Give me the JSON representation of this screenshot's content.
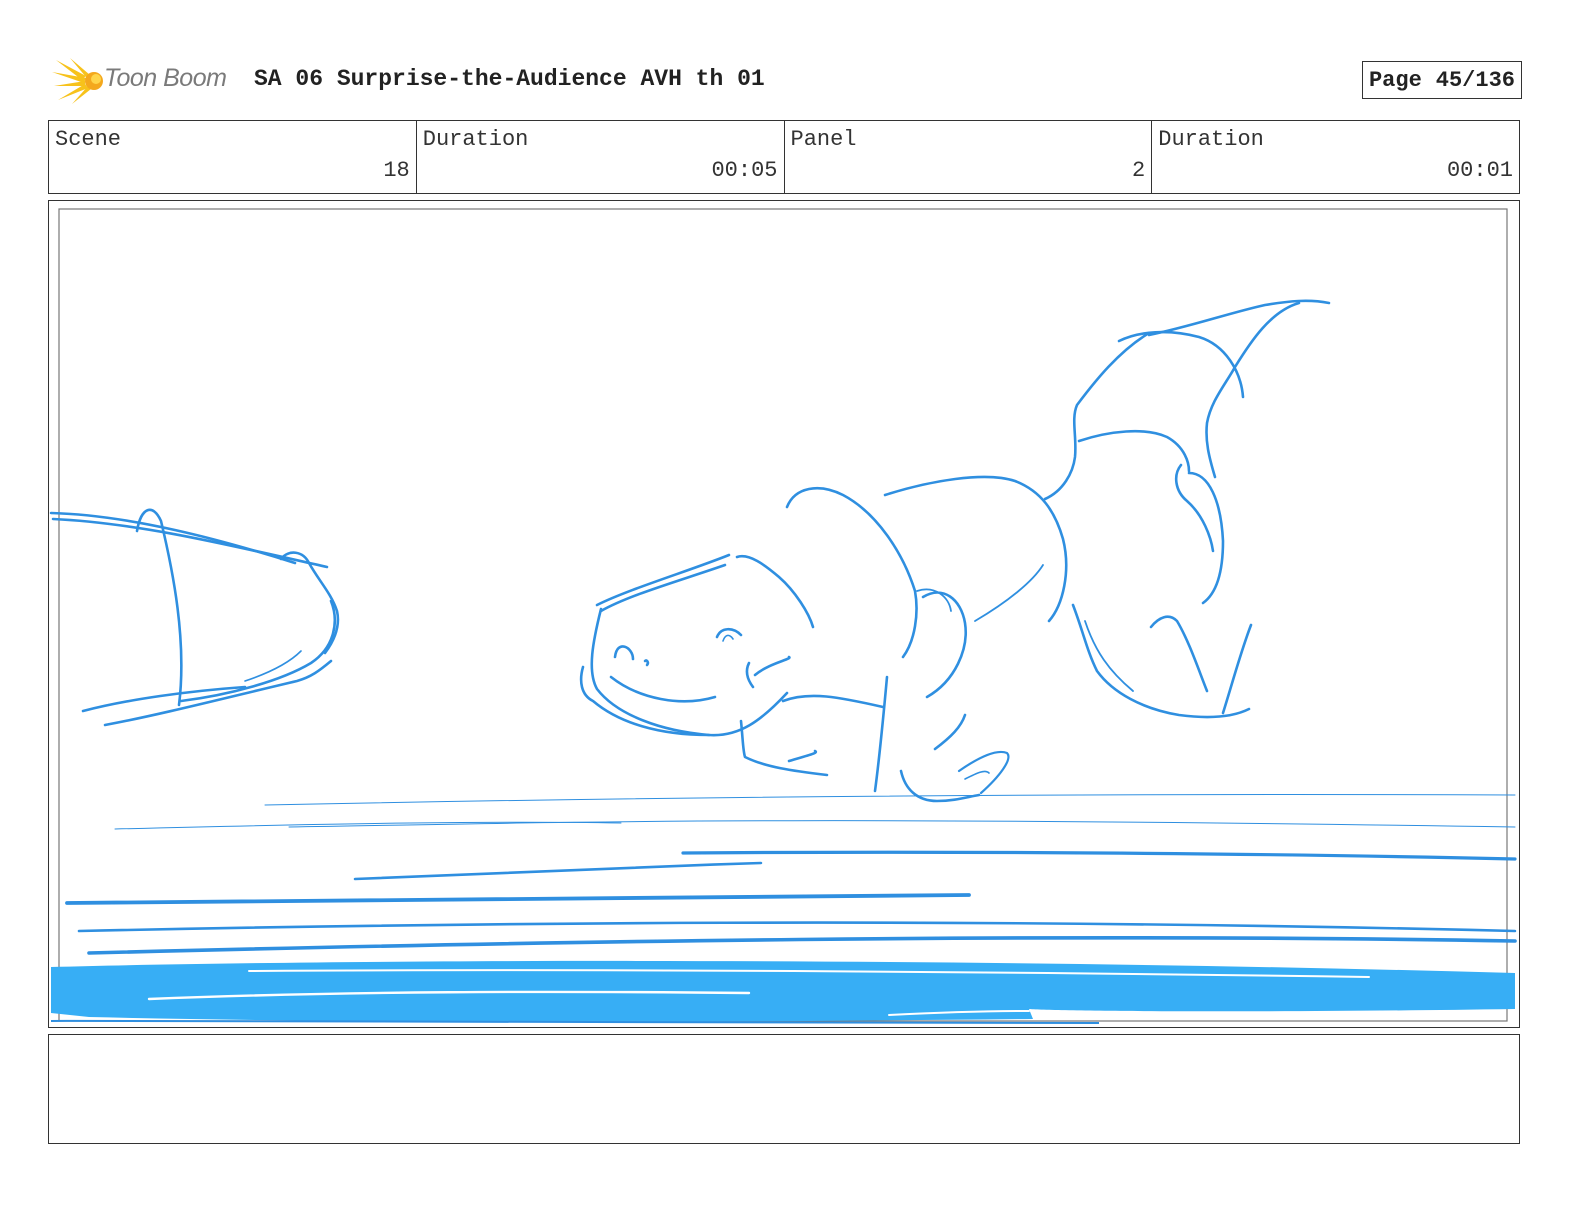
{
  "header": {
    "logo_text": "Toon Boom",
    "title": "SA 06 Surprise-the-Audience AVH th 01",
    "page_label": "Page",
    "page_number": "45/136"
  },
  "info": {
    "scene_label": "Scene",
    "scene_value": "18",
    "scene_duration_label": "Duration",
    "scene_duration_value": "00:05",
    "panel_label": "Panel",
    "panel_value": "2",
    "panel_duration_label": "Duration",
    "panel_duration_value": "00:01"
  },
  "colors": {
    "sketch_stroke": "#2f8fe0",
    "sketch_fill": "#37aef5",
    "border": "#333333"
  },
  "icons": {
    "logo": "toon-boom-starburst-icon"
  },
  "notes": {
    "text": ""
  }
}
